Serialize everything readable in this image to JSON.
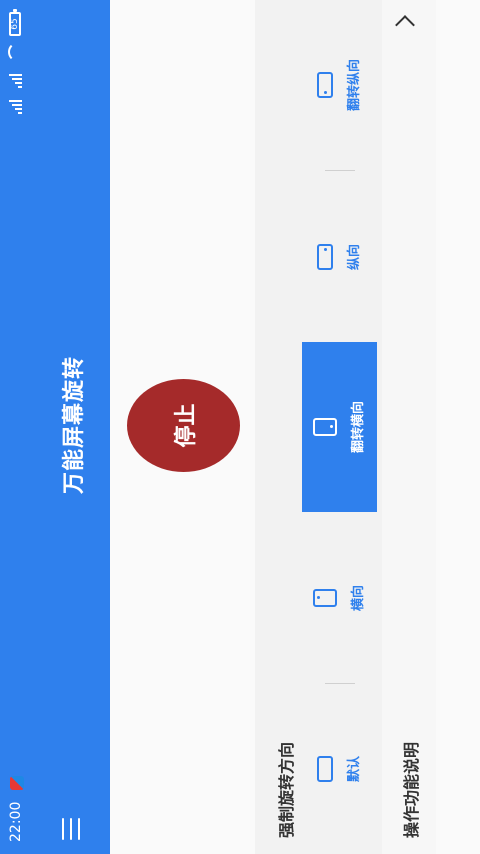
{
  "status": {
    "time": "22:00",
    "battery": "65"
  },
  "app": {
    "title": "万能屏幕旋转"
  },
  "main": {
    "stop_label": "停止"
  },
  "force": {
    "title": "强制旋转方向",
    "options": [
      {
        "label": "默认",
        "icon": "landscape-device-icon",
        "active": false
      },
      {
        "label": "横向",
        "icon": "portrait-device-icon",
        "active": false
      },
      {
        "label": "翻转横向",
        "icon": "portrait-device-icon",
        "active": true
      },
      {
        "label": "纵向",
        "icon": "landscape-device-icon",
        "active": false
      },
      {
        "label": "翻转纵向",
        "icon": "landscape-device-icon",
        "active": false
      }
    ]
  },
  "help": {
    "title": "操作功能说明"
  },
  "colors": {
    "primary": "#2f80ed",
    "stop": "#a52a2a"
  }
}
